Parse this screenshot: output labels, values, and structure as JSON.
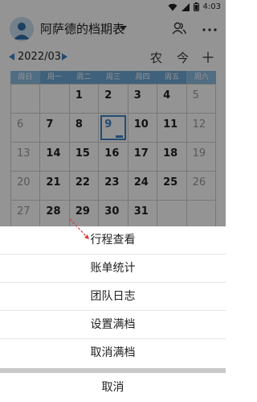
{
  "status": {
    "time": "4:03"
  },
  "header": {
    "title": "阿萨德的档期表",
    "icons": [
      "avatar",
      "caret-down-icon",
      "people-icon",
      "more-icon"
    ]
  },
  "month": {
    "label": "2022/03",
    "lunar_label": "农",
    "today_label": "今",
    "add_label": "＋"
  },
  "weekdays": [
    "周日",
    "周一",
    "周二",
    "周三",
    "周四",
    "周五",
    "周六"
  ],
  "calendar": {
    "rows": [
      [
        "",
        "",
        "1",
        "2",
        "3",
        "4",
        "5"
      ],
      [
        "6",
        "7",
        "8",
        "9",
        "10",
        "11",
        "12"
      ],
      [
        "13",
        "14",
        "15",
        "16",
        "17",
        "18",
        "19"
      ],
      [
        "20",
        "21",
        "22",
        "23",
        "24",
        "25",
        "26"
      ],
      [
        "27",
        "28",
        "29",
        "30",
        "31",
        "",
        ""
      ]
    ],
    "today": "9"
  },
  "sheet": {
    "options": [
      "行程查看",
      "账单统计",
      "团队日志",
      "设置满档",
      "取消满档"
    ],
    "cancel_label": "取消"
  },
  "colors": {
    "accent": "#3d82c7",
    "week_header": "#6fa7d5",
    "pointer": "#d23a3a"
  }
}
